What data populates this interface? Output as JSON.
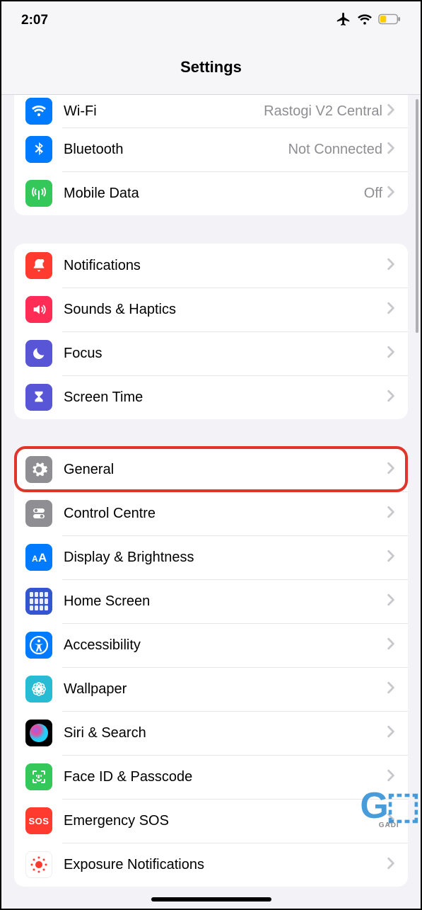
{
  "status": {
    "time": "2:07"
  },
  "header": {
    "title": "Settings"
  },
  "sections": [
    {
      "rows": [
        {
          "icon": "wifi",
          "bg": "#007aff",
          "label": "Wi-Fi",
          "value": "Rastogi V2 Central"
        },
        {
          "icon": "bluetooth",
          "bg": "#007aff",
          "label": "Bluetooth",
          "value": "Not Connected"
        },
        {
          "icon": "antenna",
          "bg": "#34c759",
          "label": "Mobile Data",
          "value": "Off"
        }
      ]
    },
    {
      "rows": [
        {
          "icon": "bell",
          "bg": "#ff3b30",
          "label": "Notifications"
        },
        {
          "icon": "speaker",
          "bg": "#ff2d55",
          "label": "Sounds & Haptics"
        },
        {
          "icon": "moon",
          "bg": "#5856d6",
          "label": "Focus"
        },
        {
          "icon": "hourglass",
          "bg": "#5856d6",
          "label": "Screen Time"
        }
      ]
    },
    {
      "rows": [
        {
          "icon": "gear",
          "bg": "#8e8e93",
          "label": "General",
          "highlight": true
        },
        {
          "icon": "switches",
          "bg": "#8e8e93",
          "label": "Control Centre"
        },
        {
          "icon": "textsize",
          "bg": "#007aff",
          "label": "Display & Brightness"
        },
        {
          "icon": "homescreen",
          "bg": "#3355cf",
          "label": "Home Screen"
        },
        {
          "icon": "accessibility",
          "bg": "#007aff",
          "label": "Accessibility"
        },
        {
          "icon": "wallpaper",
          "bg": "#28bcd4",
          "label": "Wallpaper"
        },
        {
          "icon": "siri",
          "bg": "#000",
          "label": "Siri & Search"
        },
        {
          "icon": "faceid",
          "bg": "#34c759",
          "label": "Face ID & Passcode"
        },
        {
          "icon": "sos",
          "bg": "#ff3b30",
          "label": "Emergency SOS"
        },
        {
          "icon": "exposure",
          "bg": "#fff",
          "label": "Exposure Notifications"
        }
      ]
    }
  ],
  "highlight_label": "General"
}
